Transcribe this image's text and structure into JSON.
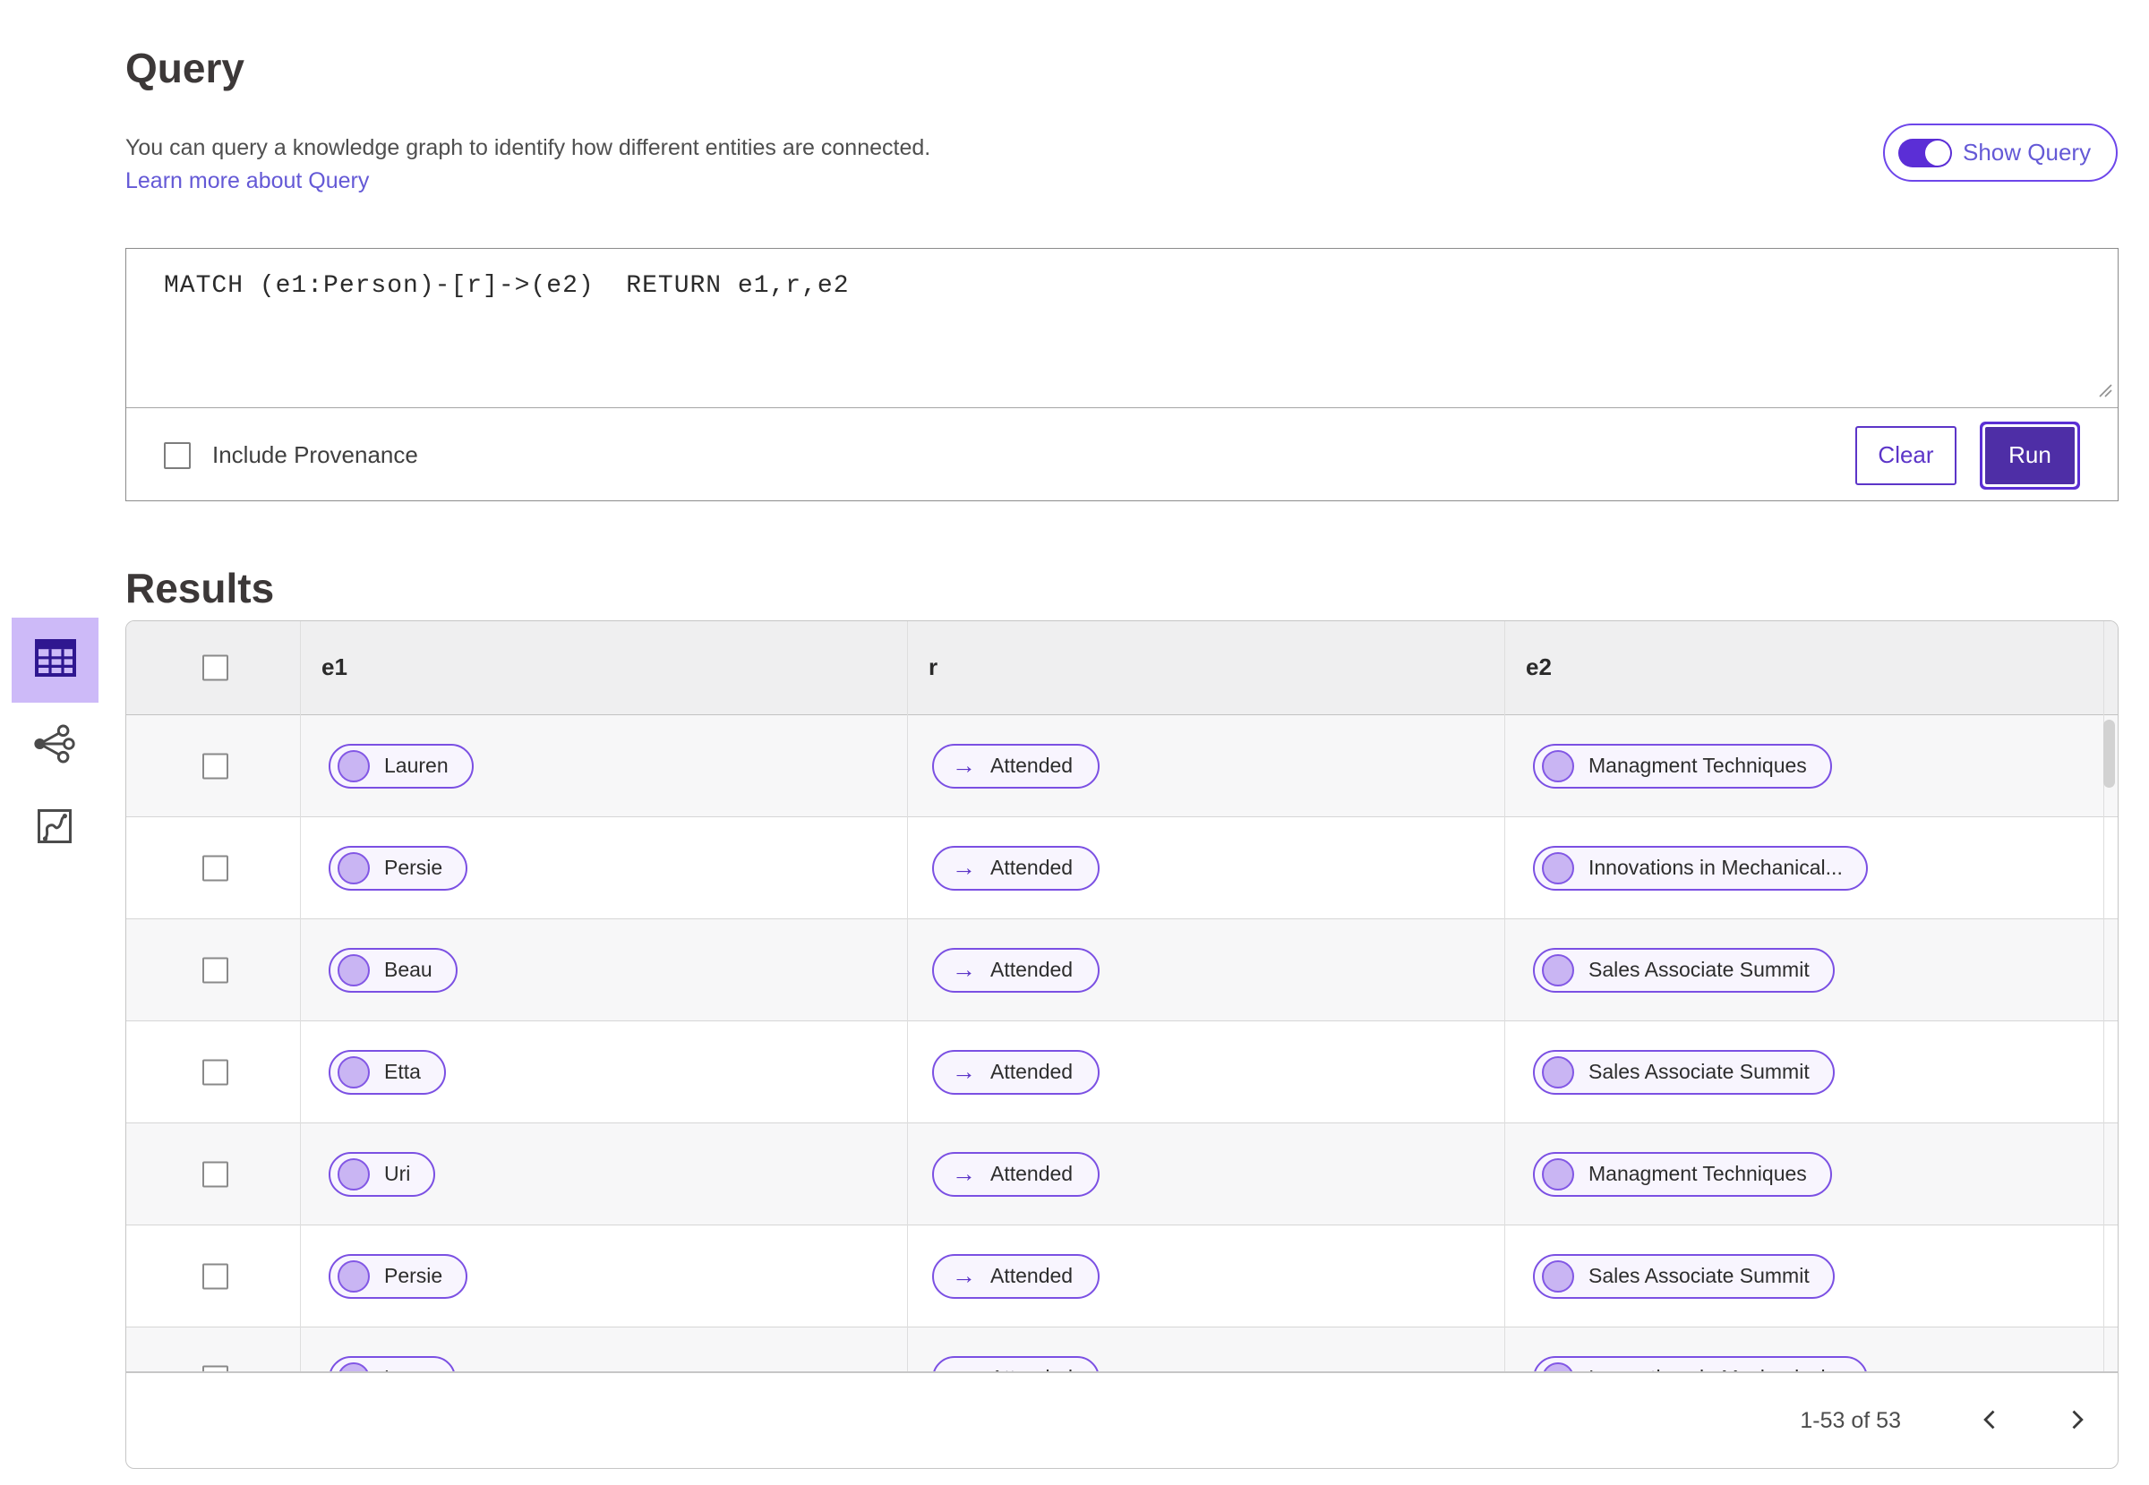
{
  "header": {
    "title": "Query",
    "description": "You can query a knowledge graph to identify how different entities are connected.",
    "learn_more_link": "Learn more about Query",
    "show_query_label": "Show Query",
    "show_query_on": true
  },
  "query_editor": {
    "query_text": "MATCH (e1:Person)-[r]->(e2)  RETURN e1,r,e2",
    "include_provenance_label": "Include Provenance",
    "include_provenance_checked": false,
    "clear_button": "Clear",
    "run_button": "Run"
  },
  "results": {
    "title": "Results",
    "view_switcher": [
      {
        "name": "table-view",
        "selected": true
      },
      {
        "name": "graph-view",
        "selected": false
      },
      {
        "name": "chart-view",
        "selected": false
      }
    ],
    "table": {
      "columns": [
        "e1",
        "r",
        "e2"
      ],
      "rows": [
        {
          "e1": "Lauren",
          "r": "Attended",
          "e2": "Managment Techniques"
        },
        {
          "e1": "Persie",
          "r": "Attended",
          "e2": "Innovations in Mechanical..."
        },
        {
          "e1": "Beau",
          "r": "Attended",
          "e2": "Sales Associate Summit"
        },
        {
          "e1": "Etta",
          "r": "Attended",
          "e2": "Sales Associate Summit"
        },
        {
          "e1": "Uri",
          "r": "Attended",
          "e2": "Managment Techniques"
        },
        {
          "e1": "Persie",
          "r": "Attended",
          "e2": "Sales Associate Summit"
        },
        {
          "e1": "Larry",
          "r": "Attended",
          "e2": "Innovations in Mechanical..."
        }
      ]
    },
    "pagination": {
      "range_label": "1-53 of 53"
    }
  },
  "icons": {
    "arrow_right": "→",
    "chevron_left": "chevron-left",
    "chevron_right": "chevron-right"
  },
  "colors": {
    "accent_purple": "#5b2fd4",
    "run_button_fill": "#4e2ea6",
    "pill_border": "#7b50e3",
    "pill_background": "#f8f5fe",
    "node_fill": "#c9b5f3",
    "link_text": "#6459d6",
    "selected_view_background": "#cdbaf8",
    "table_header_background": "#efeff0",
    "row_alternate_background": "#f7f7f8"
  }
}
